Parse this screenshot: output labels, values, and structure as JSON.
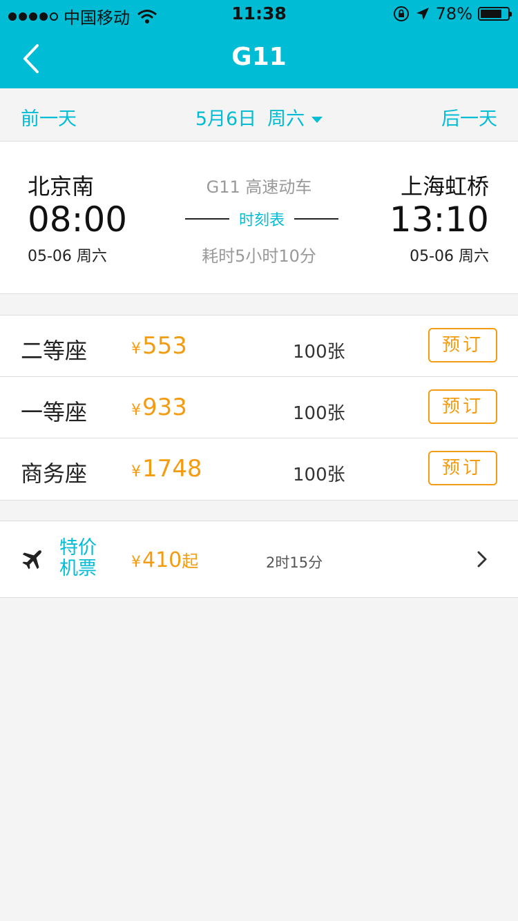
{
  "status_bar": {
    "carrier": "中国移动",
    "time": "11:38",
    "battery": "78%",
    "battery_level": 0.78
  },
  "nav": {
    "title": "G11"
  },
  "date_bar": {
    "prev_label": "前一天",
    "date": "5月6日",
    "weekday": "周六",
    "next_label": "后一天"
  },
  "train": {
    "from_station": "北京南",
    "depart_time": "08:00",
    "depart_date": "05-06 周六",
    "train_info": "G11 高速动车",
    "schedule_label": "时刻表",
    "duration": "耗时5小时10分",
    "to_station": "上海虹桥",
    "arrive_time": "13:10",
    "arrive_date": "05-06 周六"
  },
  "seats": [
    {
      "name": "二等座",
      "currency": "¥",
      "price": "553",
      "remaining": "100张",
      "book_label": "预订"
    },
    {
      "name": "一等座",
      "currency": "¥",
      "price": "933",
      "remaining": "100张",
      "book_label": "预订"
    },
    {
      "name": "商务座",
      "currency": "¥",
      "price": "1748",
      "remaining": "100张",
      "book_label": "预订"
    }
  ],
  "flight": {
    "label": "特价机票",
    "currency": "¥",
    "price": "410",
    "price_suffix": "起",
    "duration": "2时15分"
  },
  "colors": {
    "accent": "#00bcd4",
    "price": "#f39c12",
    "background": "#f4f4f4"
  }
}
